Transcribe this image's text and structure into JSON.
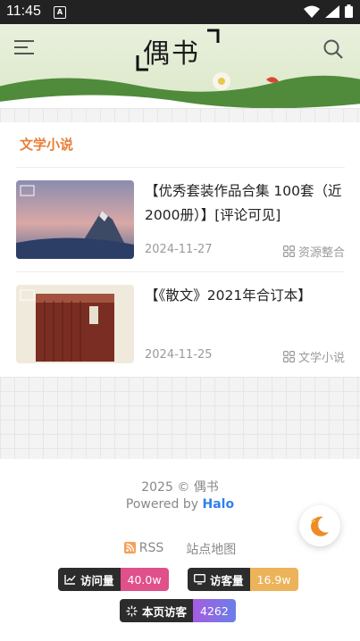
{
  "status_bar": {
    "time": "11:45",
    "sim_label": "A"
  },
  "header": {
    "site_name": "偶书"
  },
  "section": {
    "title": "文学小说"
  },
  "posts": [
    {
      "title": "【优秀套装作品合集 100套（近2000册）】[评论可见]",
      "date": "2024-11-27",
      "category": "资源整合",
      "thumb": "mountain-snow-dusk"
    },
    {
      "title": "【《散文》2021年合订本】",
      "date": "2024-11-25",
      "category": "文学小说",
      "thumb": "book-box-set"
    }
  ],
  "footer": {
    "copyright": "2025 ©  偶书",
    "powered_prefix": "Powered by",
    "powered_name": "Halo",
    "rss": "RSS",
    "sitemap": "站点地图"
  },
  "badges": [
    {
      "label": "访问量",
      "value": "40.0w",
      "icon": "chart-line-icon",
      "color": "#e0508a"
    },
    {
      "label": "访客量",
      "value": "16.9w",
      "icon": "monitor-icon",
      "color": "#ecb35a"
    },
    {
      "label": "本页访客",
      "value": "4262",
      "icon": "sparkle-icon",
      "color": "#8a63e8"
    }
  ],
  "colors": {
    "accent": "#e87d36",
    "link": "#2f80ed",
    "header_bg": "#dbe8c8"
  }
}
